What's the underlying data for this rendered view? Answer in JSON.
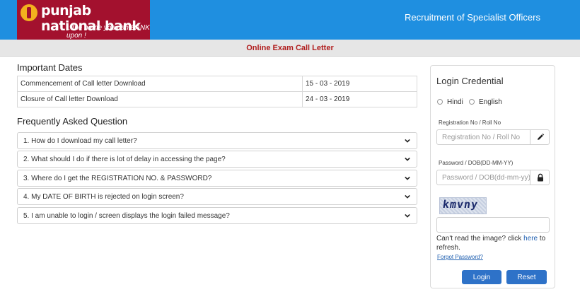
{
  "header": {
    "bank_name": "punjab national bank",
    "tagline": "...the name you can BANK upon !",
    "title": "Recruitment of Specialist Officers"
  },
  "subbar": {
    "title": "Online Exam Call Letter"
  },
  "important_dates": {
    "heading": "Important Dates",
    "rows": [
      {
        "label": "Commencement of Call letter Download",
        "value": "15 - 03 - 2019"
      },
      {
        "label": "Closure of Call letter Download",
        "value": "24 - 03 - 2019"
      }
    ]
  },
  "faq": {
    "heading": "Frequently Asked Question",
    "items": [
      "1. How do I download my call letter?",
      "2. What should I do if there is lot of delay in accessing the page?",
      "3. Where do I get the REGISTRATION NO. & PASSWORD?",
      "4. My DATE OF BIRTH is rejected on login screen?",
      "5. I am unable to login / screen displays the login failed message?"
    ]
  },
  "login": {
    "title": "Login Credential",
    "languages": [
      "Hindi",
      "English"
    ],
    "reg_label": "Registration No / Roll No",
    "reg_placeholder": "Registration No / Roll No",
    "pwd_label": "Password / DOB(DD-MM-YY)",
    "pwd_placeholder": "Password / DOB(dd-mm-yy)",
    "captcha_text": "kmvny",
    "help_text": "Can't read the image? click ",
    "help_link": "here",
    "help_text_end": " to refresh.",
    "forgot": "Forgot Password?",
    "login_button": "Login",
    "reset_button": "Reset"
  },
  "icons": {
    "edit": "pencil-icon",
    "lock": "lock-icon",
    "chevron": "chevron-down-icon"
  },
  "colors": {
    "header_blue": "#1f8fe0",
    "logo_red": "#a3112e",
    "button_blue": "#2e72c8",
    "subbar_text": "#b01e1e"
  }
}
